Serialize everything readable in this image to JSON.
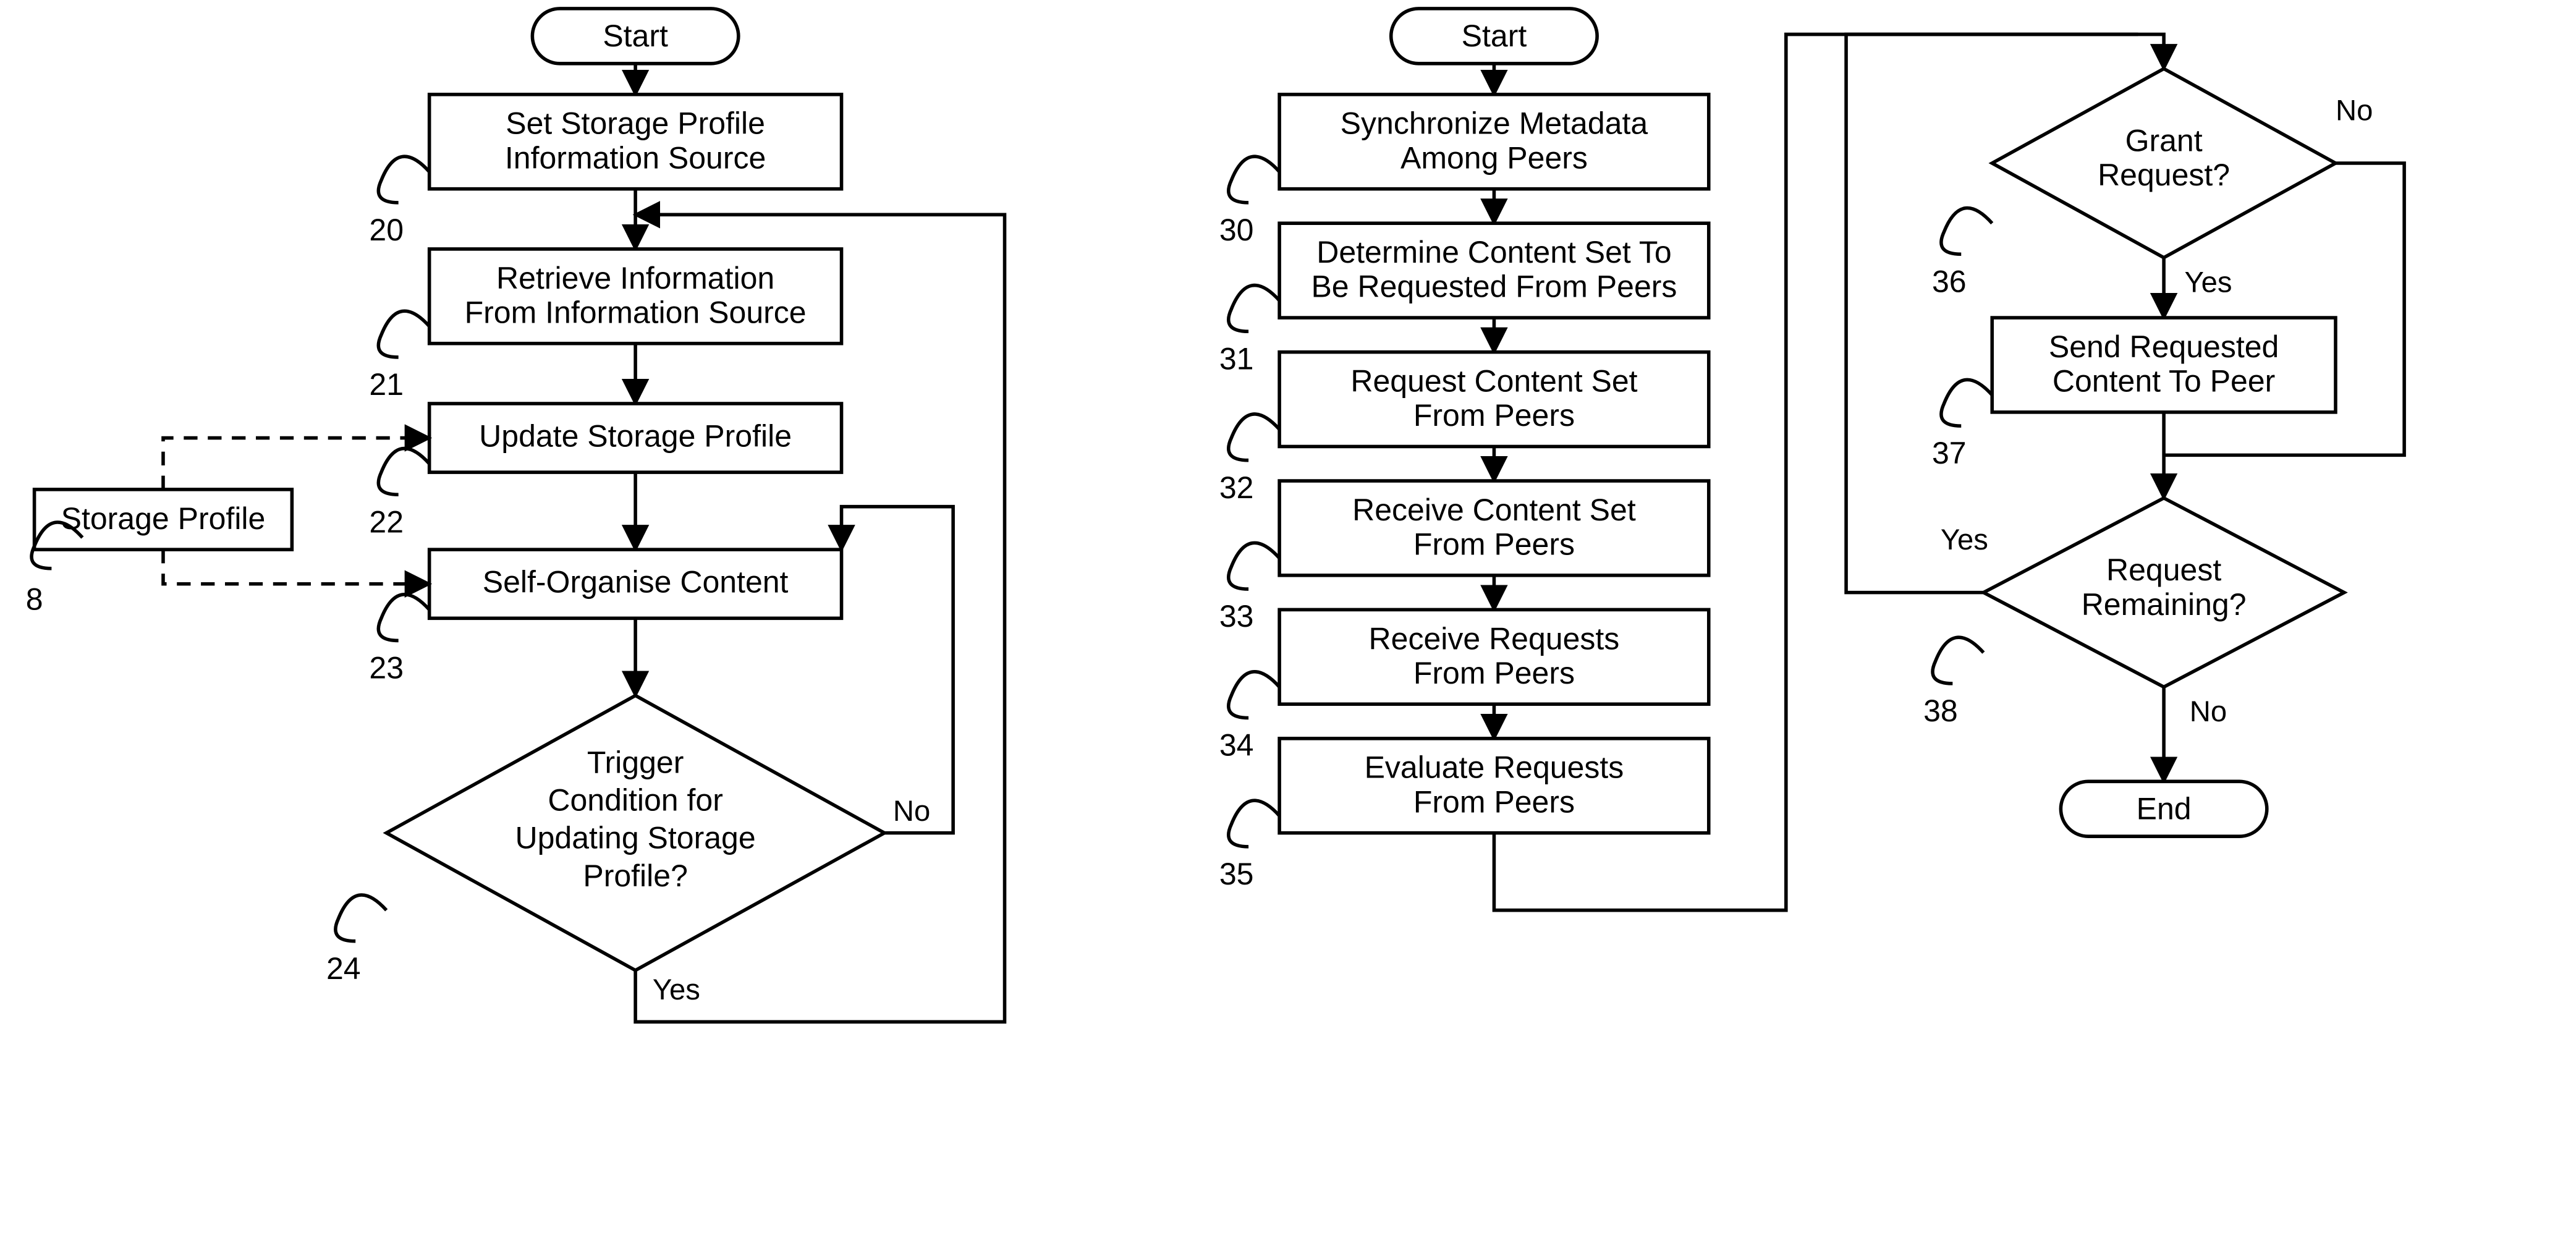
{
  "left": {
    "start": "Start",
    "n20": {
      "ref": "20",
      "text": [
        "Set Storage Profile",
        "Information Source"
      ]
    },
    "n21": {
      "ref": "21",
      "text": [
        "Retrieve Information",
        "From Information Source"
      ]
    },
    "n22": {
      "ref": "22",
      "text": [
        "Update Storage Profile"
      ]
    },
    "n23": {
      "ref": "23",
      "text": [
        "Self-Organise Content"
      ]
    },
    "n24": {
      "ref": "24",
      "text": [
        "Trigger",
        "Condition for",
        "Updating Storage",
        "Profile?"
      ]
    },
    "n24_no": "No",
    "n24_yes": "Yes",
    "sp": {
      "ref": "8",
      "text": "Storage Profile"
    }
  },
  "mid": {
    "start": "Start",
    "n30": {
      "ref": "30",
      "text": [
        "Synchronize Metadata",
        "Among Peers"
      ]
    },
    "n31": {
      "ref": "31",
      "text": [
        "Determine Content Set To",
        "Be Requested From Peers"
      ]
    },
    "n32": {
      "ref": "32",
      "text": [
        "Request Content Set",
        "From Peers"
      ]
    },
    "n33": {
      "ref": "33",
      "text": [
        "Receive Content Set",
        "From Peers"
      ]
    },
    "n34": {
      "ref": "34",
      "text": [
        "Receive Requests",
        "From Peers"
      ]
    },
    "n35": {
      "ref": "35",
      "text": [
        "Evaluate Requests",
        "From Peers"
      ]
    }
  },
  "right": {
    "n36": {
      "ref": "36",
      "text": [
        "Grant",
        "Request?"
      ]
    },
    "n36_no": "No",
    "n36_yes": "Yes",
    "n37": {
      "ref": "37",
      "text": [
        "Send Requested",
        "Content To Peer"
      ]
    },
    "n38": {
      "ref": "38",
      "text": [
        "Request",
        "Remaining?"
      ]
    },
    "n38_no": "No",
    "n38_yes": "Yes",
    "end": "End"
  }
}
